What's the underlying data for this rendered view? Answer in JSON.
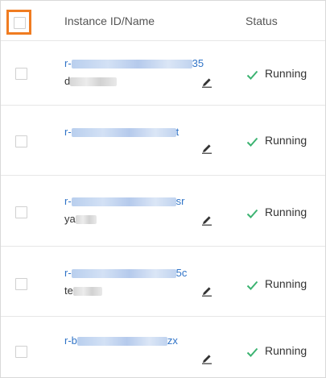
{
  "header": {
    "instance_col": "Instance ID/Name",
    "status_col": "Status"
  },
  "rows": [
    {
      "id_prefix": "r-",
      "id_suffix": "35",
      "name_prefix": "d",
      "name_suffix": "",
      "status": "Running"
    },
    {
      "id_prefix": "r-",
      "id_suffix": "t",
      "name_prefix": "",
      "name_suffix": "",
      "status": "Running"
    },
    {
      "id_prefix": "r-",
      "id_suffix": "sr",
      "name_prefix": "ya",
      "name_suffix": "",
      "status": "Running"
    },
    {
      "id_prefix": "r-",
      "id_suffix": "5c",
      "name_prefix": "te",
      "name_suffix": "",
      "status": "Running"
    },
    {
      "id_prefix": "r-b",
      "id_suffix": "zx",
      "name_prefix": "",
      "name_suffix": "",
      "status": "Running"
    }
  ],
  "colors": {
    "highlight": "#f07c21",
    "link": "#2f73c7",
    "status_ok": "#3cb371"
  },
  "icons": {
    "row_edit": "pencil-edit-icon",
    "row_status": "checkmark-icon"
  }
}
